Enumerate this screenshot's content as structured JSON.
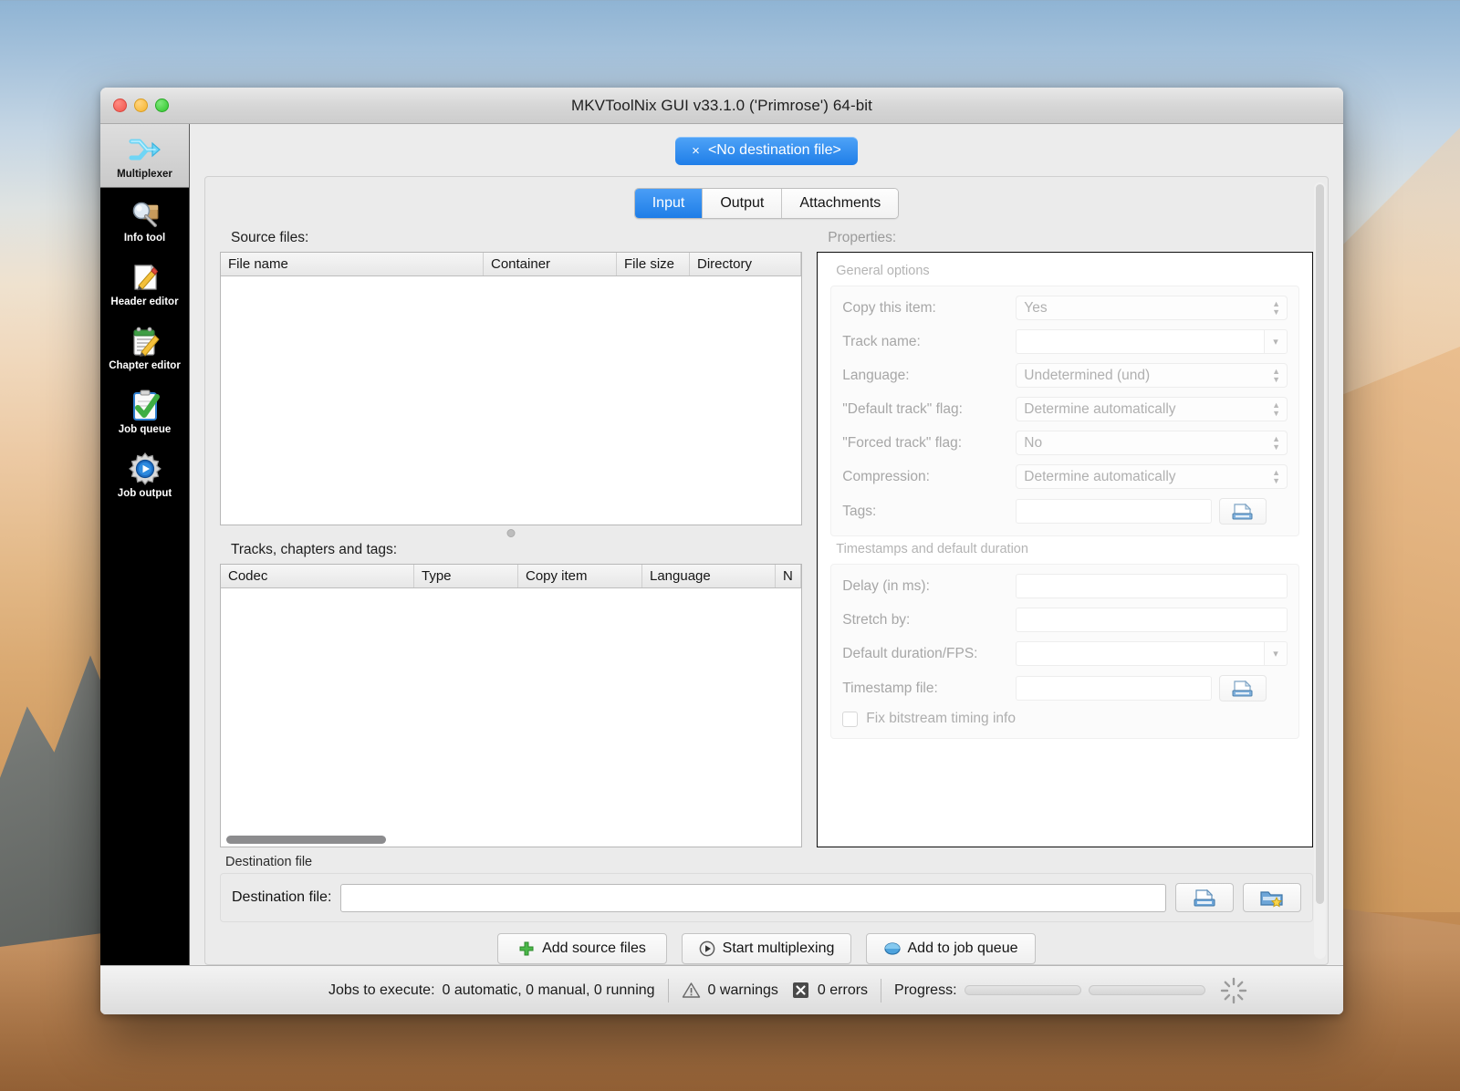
{
  "window": {
    "title": "MKVToolNix GUI v33.1.0 ('Primrose') 64-bit",
    "traffic_lights": {
      "close": "close",
      "minimize": "minimize",
      "zoom": "zoom"
    }
  },
  "sidebar": {
    "items": [
      {
        "label": "Multiplexer",
        "icon": "multiplexer-icon",
        "active": true
      },
      {
        "label": "Info tool",
        "icon": "info-tool-icon",
        "active": false
      },
      {
        "label": "Header editor",
        "icon": "header-editor-icon",
        "active": false
      },
      {
        "label": "Chapter editor",
        "icon": "chapter-editor-icon",
        "active": false
      },
      {
        "label": "Job queue",
        "icon": "job-queue-icon",
        "active": false
      },
      {
        "label": "Job output",
        "icon": "job-output-icon",
        "active": false
      }
    ]
  },
  "destination_pill": {
    "close_glyph": "×",
    "label": "<No destination file>"
  },
  "tabs": [
    {
      "label": "Input",
      "active": true
    },
    {
      "label": "Output",
      "active": false
    },
    {
      "label": "Attachments",
      "active": false
    }
  ],
  "source_files": {
    "label": "Source files:",
    "columns": [
      "File name",
      "Container",
      "File size",
      "Directory"
    ],
    "rows": []
  },
  "tracks": {
    "label": "Tracks, chapters and tags:",
    "columns": [
      "Codec",
      "Type",
      "Copy item",
      "Language",
      "N"
    ],
    "rows": []
  },
  "properties": {
    "label": "Properties:",
    "general_options": {
      "title": "General options",
      "fields": [
        {
          "label": "Copy this item:",
          "value": "Yes",
          "kind": "select"
        },
        {
          "label": "Track name:",
          "value": "",
          "kind": "combo"
        },
        {
          "label": "Language:",
          "value": "Undetermined (und)",
          "kind": "select"
        },
        {
          "label": "\"Default track\" flag:",
          "value": "Determine automatically",
          "kind": "select"
        },
        {
          "label": "\"Forced track\" flag:",
          "value": "No",
          "kind": "select"
        },
        {
          "label": "Compression:",
          "value": "Determine automatically",
          "kind": "select"
        },
        {
          "label": "Tags:",
          "value": "",
          "kind": "text-browse"
        }
      ]
    },
    "timestamps": {
      "title": "Timestamps and default duration",
      "fields": [
        {
          "label": "Delay (in ms):",
          "value": "",
          "kind": "text"
        },
        {
          "label": "Stretch by:",
          "value": "",
          "kind": "text"
        },
        {
          "label": "Default duration/FPS:",
          "value": "",
          "kind": "combo"
        },
        {
          "label": "Timestamp file:",
          "value": "",
          "kind": "text-browse"
        }
      ],
      "checkbox": {
        "label": "Fix bitstream timing info",
        "checked": false
      }
    }
  },
  "destination": {
    "group_label": "Destination file",
    "field_label": "Destination file:",
    "value": "",
    "buttons": [
      {
        "name": "browse-destination-button",
        "icon": "save-file-icon"
      },
      {
        "name": "destination-favorites-button",
        "icon": "folder-star-icon"
      }
    ]
  },
  "actions": [
    {
      "label": "Add source files",
      "icon": "plus-icon"
    },
    {
      "label": "Start multiplexing",
      "icon": "play-icon"
    },
    {
      "label": "Add to job queue",
      "icon": "job-queue-icon"
    }
  ],
  "statusbar": {
    "jobs_label": "Jobs to execute:",
    "jobs_value": "0 automatic, 0 manual, 0 running",
    "warnings": "0 warnings",
    "errors": "0 errors",
    "progress_label": "Progress:",
    "progress_values": [
      0,
      0
    ]
  },
  "colors": {
    "accent_blue": "#1e7de7",
    "sidebar_bg": "#000000",
    "window_bg": "#ececec",
    "disabled_text": "#a7a7a7"
  }
}
